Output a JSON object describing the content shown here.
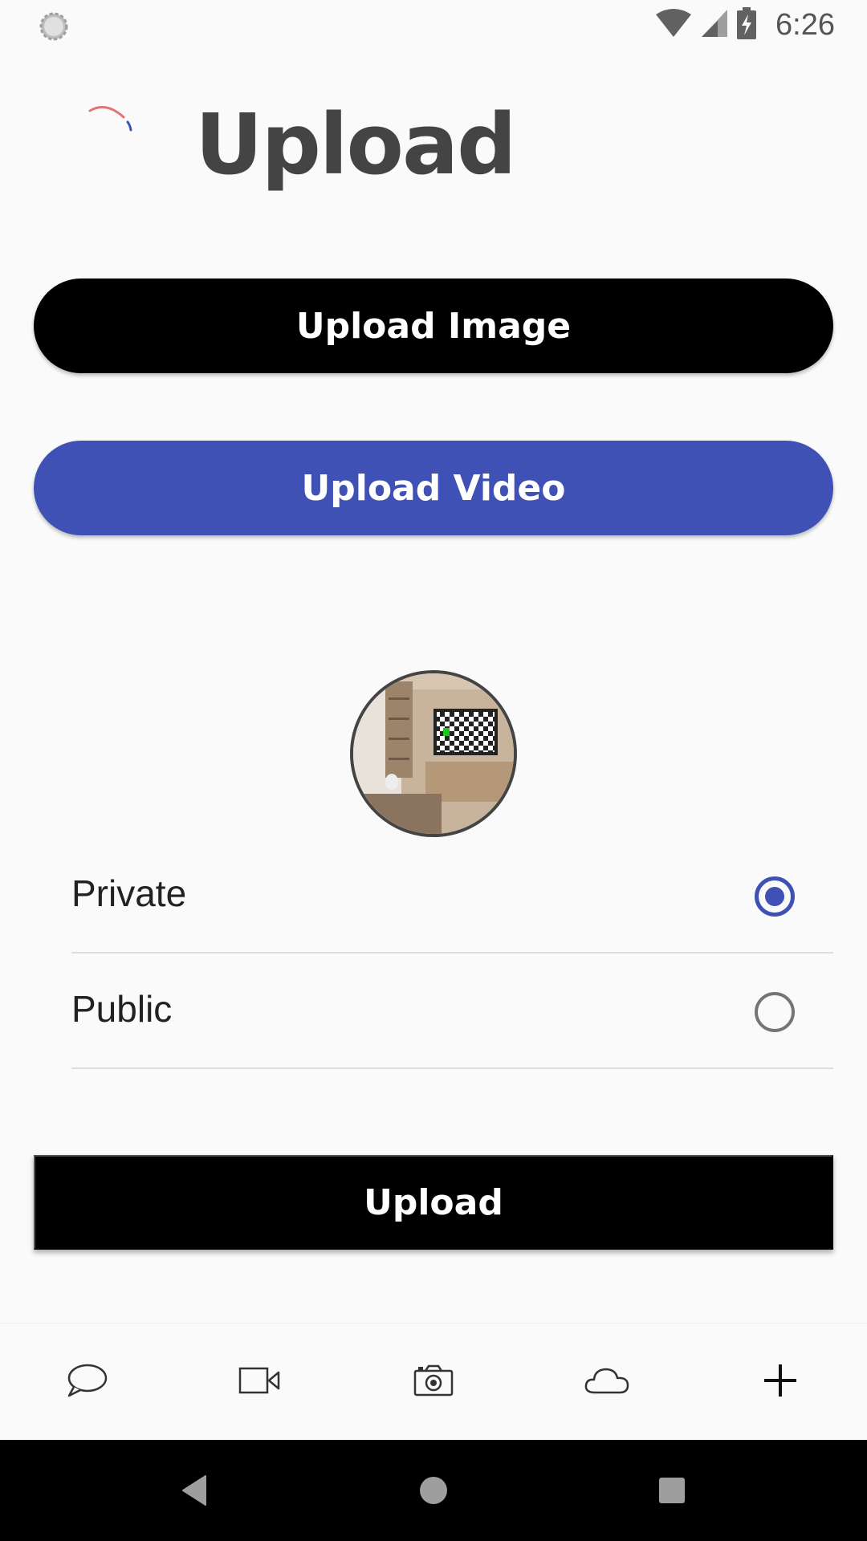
{
  "status_bar": {
    "time": "6:26",
    "icons": [
      "loading-indicator-icon",
      "wifi-icon",
      "cell-signal-icon",
      "battery-charging-icon"
    ]
  },
  "header": {
    "title": "Upload",
    "icon": "progress-spinner-icon"
  },
  "actions": {
    "upload_image_label": "Upload Image",
    "upload_video_label": "Upload Video",
    "upload_label": "Upload"
  },
  "preview": {
    "icon": "video-thumbnail"
  },
  "visibility": {
    "options": [
      {
        "label": "Private",
        "selected": true
      },
      {
        "label": "Public",
        "selected": false
      }
    ]
  },
  "bottom_nav": {
    "items": [
      "chat-icon",
      "video-camera-icon",
      "camera-icon",
      "cloud-icon",
      "add-icon"
    ]
  },
  "colors": {
    "accent": "#3f51b5",
    "primary_button": "#000000",
    "title": "#444444",
    "background": "#fafafa"
  }
}
